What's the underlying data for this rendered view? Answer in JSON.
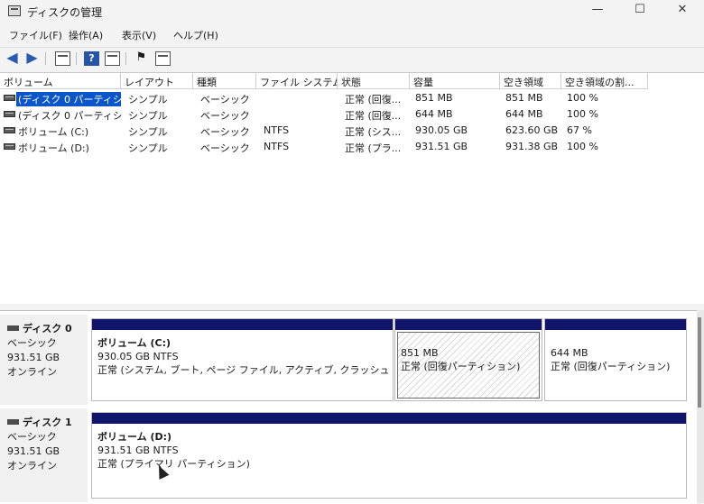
{
  "window": {
    "title": "ディスクの管理",
    "minimize": "—",
    "maximize": "☐",
    "close": "✕"
  },
  "menu": [
    "ファイル(F)",
    "操作(A)",
    "表示(V)",
    "ヘルプ(H)"
  ],
  "table": {
    "headers": [
      "ボリューム",
      "レイアウト",
      "種類",
      "ファイル システム",
      "状態",
      "容量",
      "空き領域",
      "空き領域の割..."
    ],
    "rows": [
      [
        "(ディスク 0 パーティシ...",
        "シンプル",
        "ベーシック",
        "",
        "正常 (回復...",
        "851 MB",
        "851 MB",
        "100 %"
      ],
      [
        "(ディスク 0 パーティシ...",
        "シンプル",
        "ベーシック",
        "",
        "正常 (回復...",
        "644 MB",
        "644 MB",
        "100 %"
      ],
      [
        "ボリューム (C:)",
        "シンプル",
        "ベーシック",
        "NTFS",
        "正常 (シス...",
        "930.05 GB",
        "623.60 GB",
        "67 %"
      ],
      [
        "ボリューム (D:)",
        "シンプル",
        "ベーシック",
        "NTFS",
        "正常 (プラ...",
        "931.51 GB",
        "931.38 GB",
        "100 %"
      ]
    ]
  },
  "disks": [
    {
      "name": "ディスク 0",
      "type": "ベーシック",
      "size": "931.51 GB",
      "status": "オンライン",
      "partitions": [
        {
          "name": "ボリューム (C:)",
          "size": "930.05 GB NTFS",
          "status": "正常 (システム, ブート, ページ ファイル, アクティブ, クラッシュ ダンプ, プ"
        },
        {
          "name": "",
          "size": "851 MB",
          "status": "正常 (回復パーティション)"
        },
        {
          "name": "",
          "size": "644 MB",
          "status": "正常 (回復パーティション)"
        }
      ]
    },
    {
      "name": "ディスク 1",
      "type": "ベーシック",
      "size": "931.51 GB",
      "status": "オンライン",
      "partitions": [
        {
          "name": "ボリューム (D:)",
          "size": "931.51 GB NTFS",
          "status": "正常 (プライマリ パーティション)"
        }
      ]
    }
  ],
  "colors": {
    "partition_bar": "#10146a",
    "selection": "#0a55c8"
  }
}
